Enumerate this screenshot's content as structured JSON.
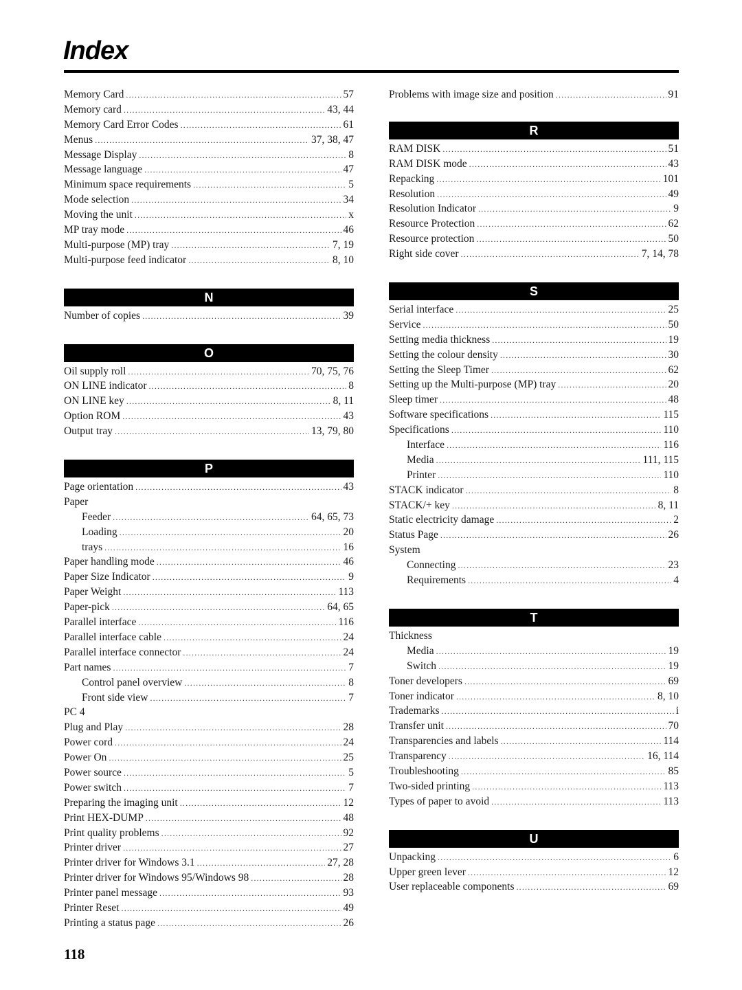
{
  "page": {
    "title": "Index",
    "page_number": "118"
  },
  "left_column": {
    "m_entries": [
      {
        "term": "Memory Card",
        "pages": "57"
      },
      {
        "term": "Memory card",
        "pages": "43, 44"
      },
      {
        "term": "Memory Card Error Codes",
        "pages": "61"
      },
      {
        "term": "Menus",
        "pages": "37, 38, 47"
      },
      {
        "term": "Message Display",
        "pages": "8"
      },
      {
        "term": "Message language",
        "pages": "47"
      },
      {
        "term": "Minimum space requirements",
        "pages": "5"
      },
      {
        "term": "Mode selection",
        "pages": "34"
      },
      {
        "term": "Moving the unit",
        "pages": "x"
      },
      {
        "term": "MP tray mode",
        "pages": "46"
      },
      {
        "term": "Multi-purpose (MP) tray",
        "pages": "7, 19"
      },
      {
        "term": "Multi-purpose feed indicator",
        "pages": "8, 10"
      }
    ],
    "n_section": {
      "letter": "N",
      "entries": [
        {
          "term": "Number of copies",
          "pages": "39"
        }
      ]
    },
    "o_section": {
      "letter": "O",
      "entries": [
        {
          "term": "Oil supply roll",
          "pages": "70, 75, 76"
        },
        {
          "term": "ON LINE indicator",
          "pages": "8"
        },
        {
          "term": "ON LINE key",
          "pages": "8, 11"
        },
        {
          "term": "Option ROM",
          "pages": "43"
        },
        {
          "term": "Output tray",
          "pages": "13, 79, 80"
        }
      ]
    },
    "p_section": {
      "letter": "P",
      "entries": [
        {
          "term": "Page orientation",
          "pages": "43"
        },
        {
          "term": "Paper",
          "pages": ""
        },
        {
          "term": "Feeder",
          "pages": "64, 65, 73",
          "sub": true
        },
        {
          "term": "Loading",
          "pages": "20",
          "sub": true
        },
        {
          "term": "trays",
          "pages": "16",
          "sub": true
        },
        {
          "term": "Paper handling mode",
          "pages": "46"
        },
        {
          "term": "Paper Size Indicator",
          "pages": "9"
        },
        {
          "term": "Paper Weight",
          "pages": "113"
        },
        {
          "term": "Paper-pick",
          "pages": "64, 65"
        },
        {
          "term": "Parallel interface",
          "pages": "116"
        },
        {
          "term": "Parallel interface cable",
          "pages": "24"
        },
        {
          "term": "Parallel interface connector",
          "pages": "24"
        },
        {
          "term": "Part names",
          "pages": "7"
        },
        {
          "term": "Control panel overview",
          "pages": "8",
          "sub": true
        },
        {
          "term": "Front side view",
          "pages": "7",
          "sub": true
        },
        {
          "term": "PC 4",
          "pages": ""
        },
        {
          "term": "Plug and Play",
          "pages": "28"
        },
        {
          "term": "Power cord",
          "pages": "24"
        },
        {
          "term": "Power On",
          "pages": "25"
        },
        {
          "term": "Power source",
          "pages": "5"
        },
        {
          "term": "Power switch",
          "pages": "7"
        },
        {
          "term": "Preparing the imaging unit",
          "pages": "12"
        },
        {
          "term": "Print HEX-DUMP",
          "pages": "48"
        },
        {
          "term": "Print quality problems",
          "pages": "92"
        },
        {
          "term": "Printer driver",
          "pages": "27"
        },
        {
          "term": "Printer driver for Windows 3.1",
          "pages": "27, 28"
        },
        {
          "term": "Printer driver for Windows 95/Windows 98",
          "pages": "28"
        },
        {
          "term": "Printer panel message",
          "pages": "93"
        },
        {
          "term": "Printer Reset",
          "pages": "49"
        },
        {
          "term": "Printing a status page",
          "pages": "26"
        }
      ]
    }
  },
  "right_column": {
    "p_continued": [
      {
        "term": "Problems with image size and position",
        "pages": "91"
      }
    ],
    "r_section": {
      "letter": "R",
      "entries": [
        {
          "term": "RAM DISK",
          "pages": "51"
        },
        {
          "term": "RAM DISK mode",
          "pages": "43"
        },
        {
          "term": "Repacking",
          "pages": "101"
        },
        {
          "term": "Resolution",
          "pages": "49"
        },
        {
          "term": "Resolution Indicator",
          "pages": "9"
        },
        {
          "term": "Resource Protection",
          "pages": "62"
        },
        {
          "term": "Resource protection",
          "pages": "50"
        },
        {
          "term": "Right side cover",
          "pages": "7, 14, 78"
        }
      ]
    },
    "s_section": {
      "letter": "S",
      "entries": [
        {
          "term": "Serial interface",
          "pages": "25"
        },
        {
          "term": "Service",
          "pages": "50"
        },
        {
          "term": "Setting media thickness",
          "pages": "19"
        },
        {
          "term": "Setting the colour density",
          "pages": "30"
        },
        {
          "term": "Setting the Sleep Timer",
          "pages": "62"
        },
        {
          "term": "Setting up the Multi-purpose (MP) tray",
          "pages": "20"
        },
        {
          "term": "Sleep timer",
          "pages": "48"
        },
        {
          "term": "Software specifications",
          "pages": "115"
        },
        {
          "term": "Specifications",
          "pages": "110"
        },
        {
          "term": "Interface",
          "pages": "116",
          "sub": true
        },
        {
          "term": "Media",
          "pages": "111, 115",
          "sub": true
        },
        {
          "term": "Printer",
          "pages": "110",
          "sub": true
        },
        {
          "term": "STACK indicator",
          "pages": "8"
        },
        {
          "term": "STACK/+ key",
          "pages": "8, 11"
        },
        {
          "term": "Static electricity damage",
          "pages": "2"
        },
        {
          "term": "Status Page",
          "pages": "26"
        },
        {
          "term": "System",
          "pages": ""
        },
        {
          "term": "Connecting",
          "pages": "23",
          "sub": true
        },
        {
          "term": "Requirements",
          "pages": "4",
          "sub": true
        }
      ]
    },
    "t_section": {
      "letter": "T",
      "entries": [
        {
          "term": "Thickness",
          "pages": ""
        },
        {
          "term": "Media",
          "pages": "19",
          "sub": true
        },
        {
          "term": "Switch",
          "pages": "19",
          "sub": true
        },
        {
          "term": "Toner developers",
          "pages": "69"
        },
        {
          "term": "Toner indicator",
          "pages": "8, 10"
        },
        {
          "term": "Trademarks",
          "pages": "i"
        },
        {
          "term": "Transfer unit",
          "pages": "70"
        },
        {
          "term": "Transparencies and labels",
          "pages": "114"
        },
        {
          "term": "Transparency",
          "pages": "16, 114"
        },
        {
          "term": "Troubleshooting",
          "pages": "85"
        },
        {
          "term": "Two-sided printing",
          "pages": "113"
        },
        {
          "term": "Types of paper to avoid",
          "pages": "113"
        }
      ]
    },
    "u_section": {
      "letter": "U",
      "entries": [
        {
          "term": "Unpacking",
          "pages": "6"
        },
        {
          "term": "Upper green lever",
          "pages": "12"
        },
        {
          "term": "User replaceable components",
          "pages": "69"
        }
      ]
    }
  }
}
